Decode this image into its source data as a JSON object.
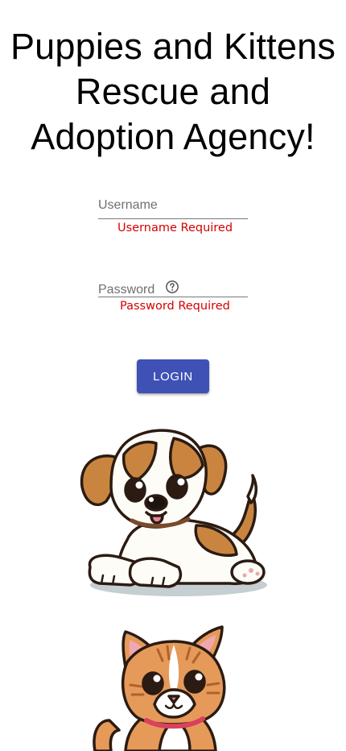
{
  "page": {
    "title_line1": "Puppies and Kittens",
    "title_line2": "Rescue and",
    "title_line3": "Adoption Agency!"
  },
  "login_form": {
    "username": {
      "label": "Username",
      "value": "",
      "error": "Username Required"
    },
    "password": {
      "label": "Password",
      "value": "",
      "help_icon": "help-circle-icon",
      "error": "Password Required"
    },
    "login_button_label": "LOGIN"
  },
  "images": {
    "puppy": "cartoon-puppy",
    "kitten": "cartoon-kitten"
  },
  "colors": {
    "button": "#3f51b5",
    "button_text": "#ffffff",
    "error": "#d50000",
    "label": "#6f6f6f"
  }
}
